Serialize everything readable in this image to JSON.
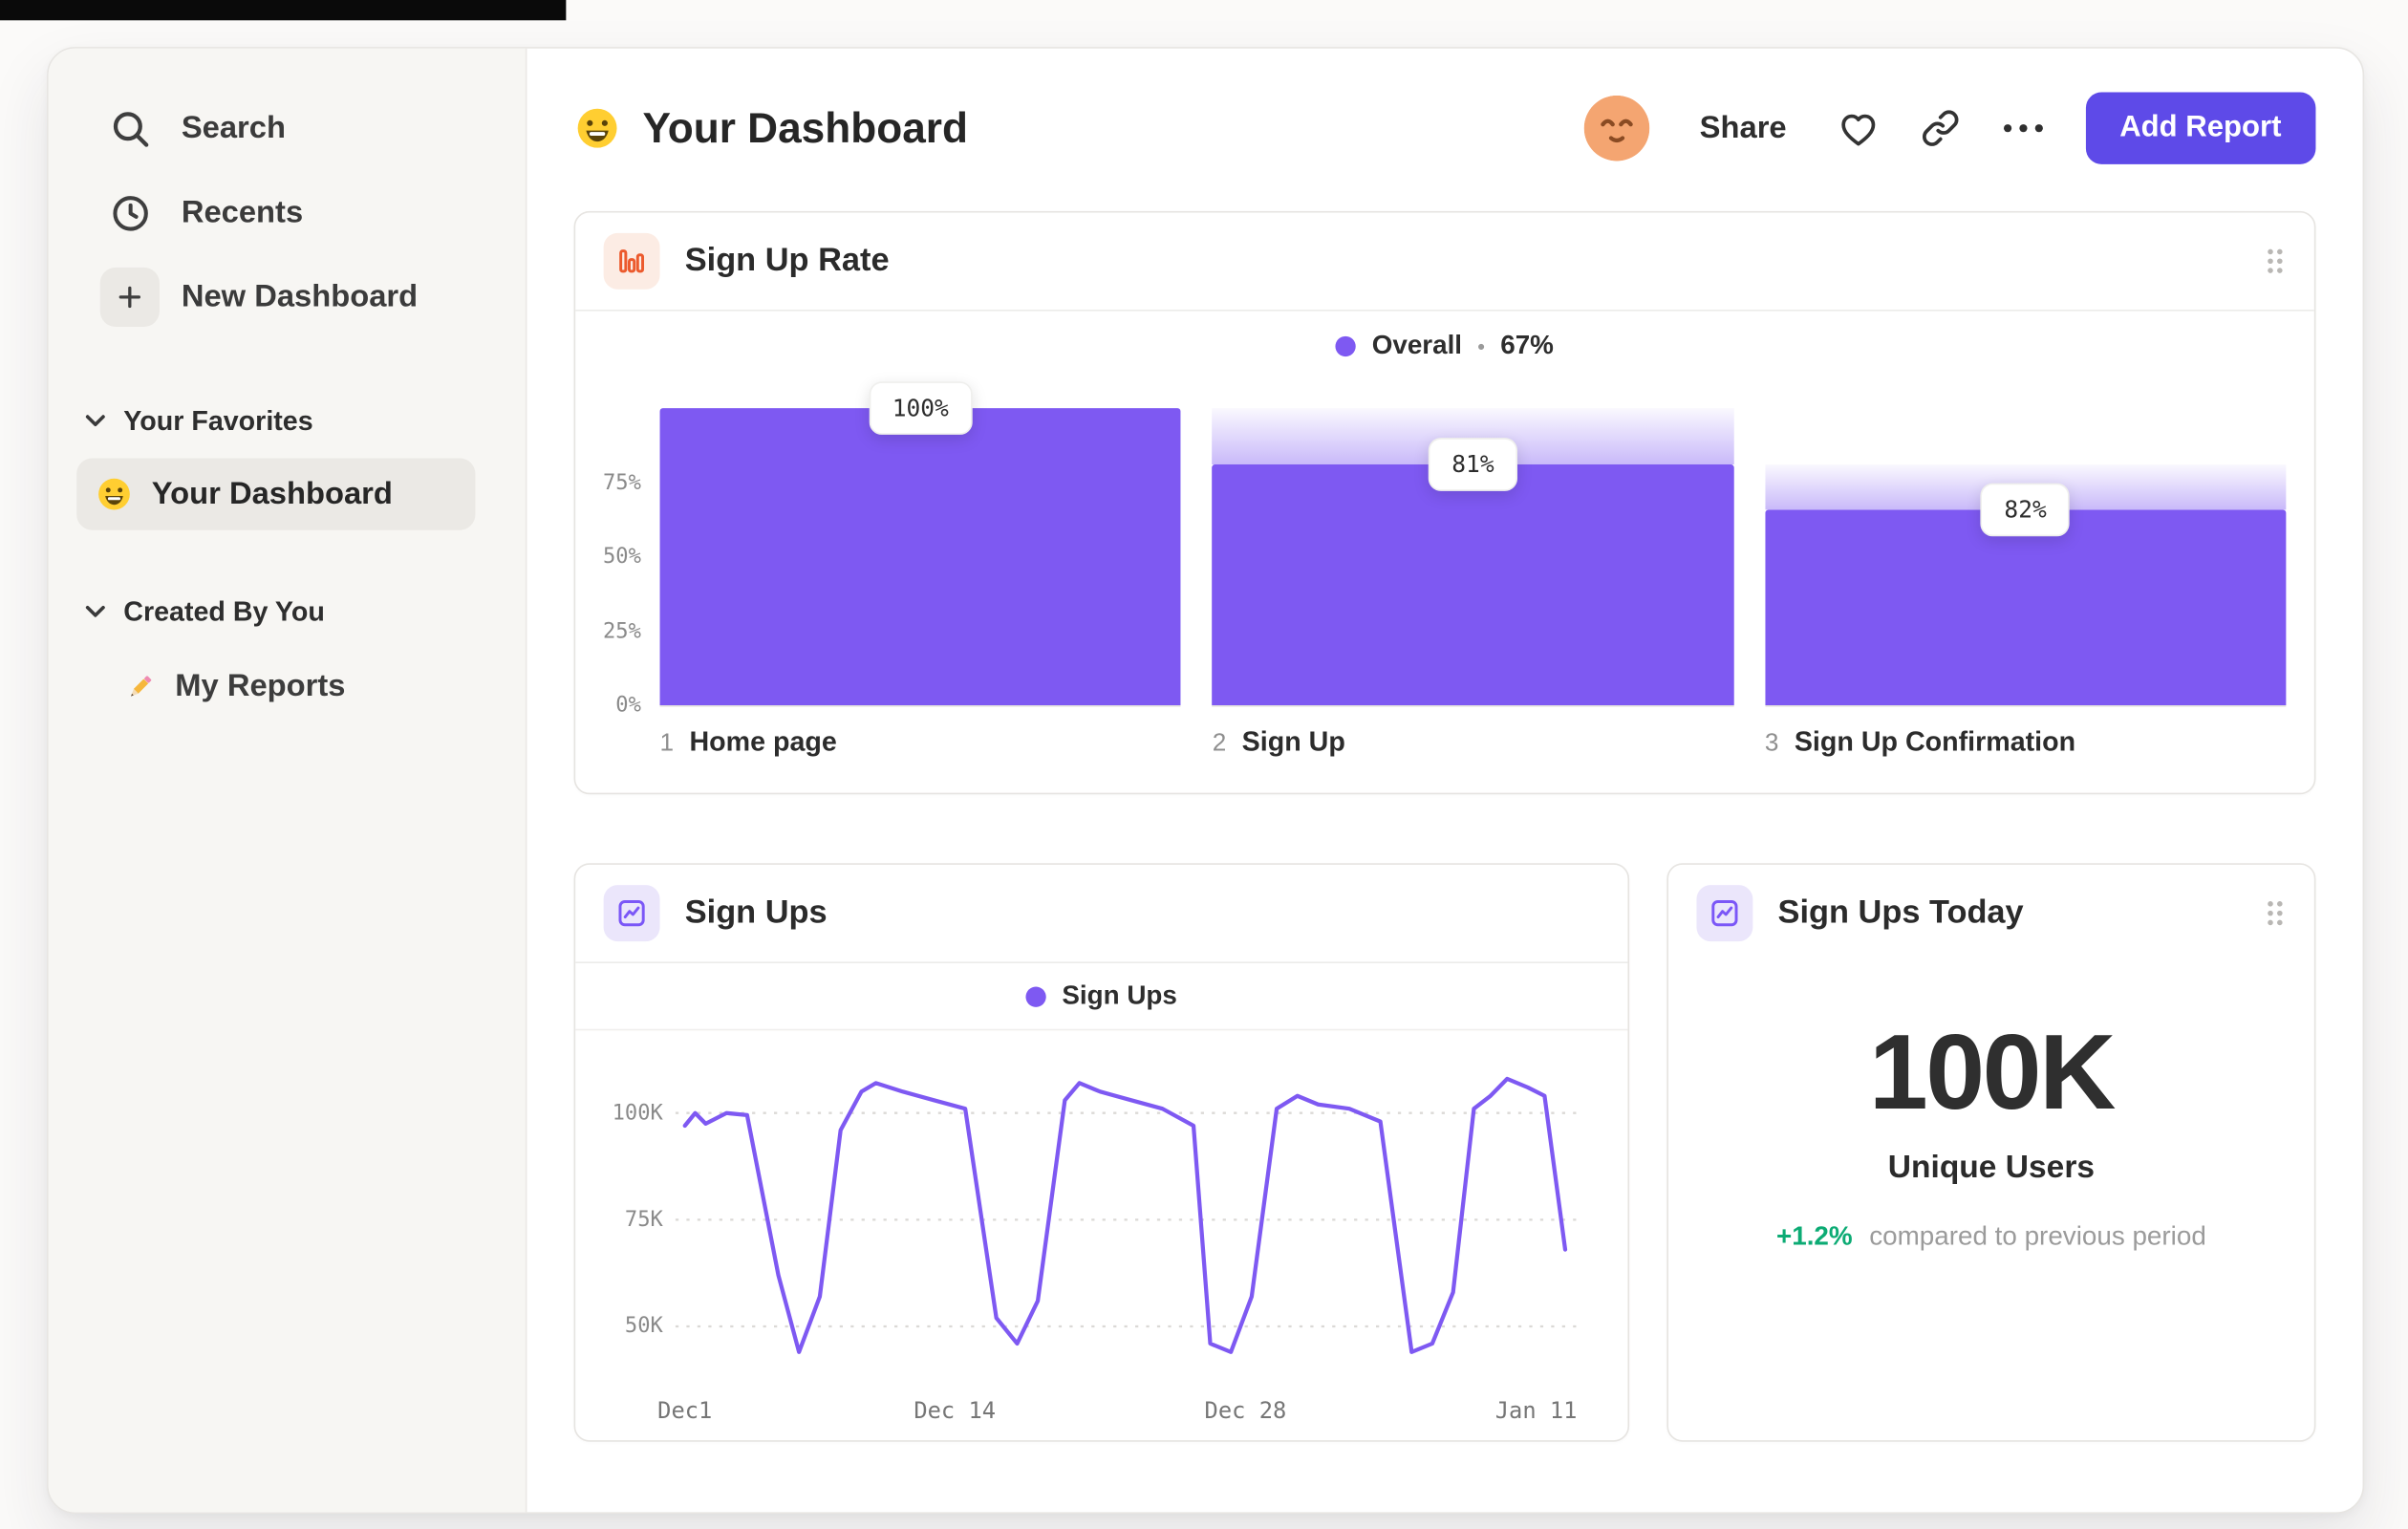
{
  "colors": {
    "accent_button": "#5e4ae8",
    "accent_bar": "#7e59f2",
    "positive_green": "#0cab74",
    "orange_icon": "#ec5a2d",
    "orange_icon_bg": "#fcece4",
    "purple_icon": "#7b57f7",
    "purple_icon_bg": "#ebe6fb",
    "sidebar_bg": "#f7f6f3",
    "selected_pill_bg": "#ebe9e5"
  },
  "sidebar": {
    "items": [
      {
        "label": "Search",
        "icon": "search-icon"
      },
      {
        "label": "Recents",
        "icon": "clock-icon"
      },
      {
        "label": "New Dashboard",
        "icon": "plus-icon"
      }
    ],
    "sections": [
      {
        "label": "Your Favorites",
        "icon": "chevron-down-icon",
        "items": [
          {
            "label": "Your Dashboard",
            "icon": "grinning-face-emoji",
            "selected": true
          }
        ]
      },
      {
        "label": "Created By You",
        "icon": "chevron-down-icon",
        "items": [
          {
            "label": "My Reports",
            "icon": "pencil-emoji",
            "selected": false
          }
        ]
      }
    ]
  },
  "header": {
    "title": "Your Dashboard",
    "title_icon": "grinning-face-emoji",
    "avatar_icon": "relieved-face-emoji",
    "share_label": "Share",
    "action_icons": [
      "heart-icon",
      "link-icon",
      "ellipsis-icon"
    ],
    "add_report_label": "Add Report"
  },
  "cards": {
    "sign_up_rate": {
      "icon": "funnel-bar-chart-icon",
      "title": "Sign Up Rate",
      "legend": {
        "label": "Overall",
        "separator": "•",
        "value": "67%"
      },
      "y_ticks": [
        {
          "label": "75%",
          "value": 75
        },
        {
          "label": "50%",
          "value": 50
        },
        {
          "label": "25%",
          "value": 25
        },
        {
          "label": "0%",
          "value": 0
        }
      ],
      "chart_data": {
        "type": "bar",
        "subtype": "funnel",
        "overall_conversion": "67%",
        "ylim": [
          0,
          100
        ],
        "steps": [
          {
            "index": "1",
            "label": "Home page",
            "value_label": "100%",
            "conversion_from_previous_pct": 100,
            "cumulative_pct": 100,
            "previous_cumulative_pct": 100
          },
          {
            "index": "2",
            "label": "Sign Up",
            "value_label": "81%",
            "conversion_from_previous_pct": 81,
            "cumulative_pct": 81,
            "previous_cumulative_pct": 100
          },
          {
            "index": "3",
            "label": "Sign Up Confirmation",
            "value_label": "82%",
            "conversion_from_previous_pct": 82,
            "cumulative_pct": 66,
            "previous_cumulative_pct": 81
          }
        ]
      }
    },
    "sign_ups": {
      "icon": "line-chart-icon",
      "title": "Sign Ups",
      "legend": {
        "label": "Sign Ups"
      },
      "chart_data": {
        "type": "line",
        "series_name": "Sign Ups",
        "unit": "K",
        "x_range": [
          0,
          43
        ],
        "y_range": [
          38,
          112
        ],
        "grid": "dotted-horizontal",
        "y_ticks": [
          {
            "label": "100K",
            "value": 100
          },
          {
            "label": "75K",
            "value": 75
          },
          {
            "label": "50K",
            "value": 50
          }
        ],
        "x_tick_labels": [
          "Dec1",
          "Dec 14",
          "Dec 28",
          "Jan 11"
        ],
        "x_tick_days": [
          0,
          13,
          27,
          41
        ],
        "points": [
          [
            0,
            97
          ],
          [
            0.5,
            100
          ],
          [
            1,
            97.5
          ],
          [
            2,
            100
          ],
          [
            3,
            99.5
          ],
          [
            4.5,
            62
          ],
          [
            5.5,
            44
          ],
          [
            6.5,
            57
          ],
          [
            7.5,
            96
          ],
          [
            8.5,
            105
          ],
          [
            9.2,
            107
          ],
          [
            10.5,
            105
          ],
          [
            12,
            103
          ],
          [
            13.5,
            101
          ],
          [
            15,
            52
          ],
          [
            16,
            46
          ],
          [
            17,
            56
          ],
          [
            18.3,
            103
          ],
          [
            19,
            107
          ],
          [
            20,
            105
          ],
          [
            21.5,
            103
          ],
          [
            23,
            101
          ],
          [
            24.5,
            97
          ],
          [
            25.3,
            46
          ],
          [
            26.3,
            44
          ],
          [
            27.3,
            57
          ],
          [
            28.5,
            101
          ],
          [
            29.5,
            104
          ],
          [
            30.5,
            102
          ],
          [
            32,
            101
          ],
          [
            33.5,
            98
          ],
          [
            35,
            44
          ],
          [
            36,
            46
          ],
          [
            37,
            58
          ],
          [
            38,
            101
          ],
          [
            38.8,
            104
          ],
          [
            39.6,
            108
          ],
          [
            40.6,
            106
          ],
          [
            41.4,
            104
          ],
          [
            42.4,
            68
          ]
        ]
      }
    },
    "sign_ups_today": {
      "icon": "line-chart-icon",
      "title": "Sign Ups Today",
      "value": "100K",
      "label": "Unique Users",
      "delta": "+1.2%",
      "delta_description": "compared to previous period"
    }
  }
}
